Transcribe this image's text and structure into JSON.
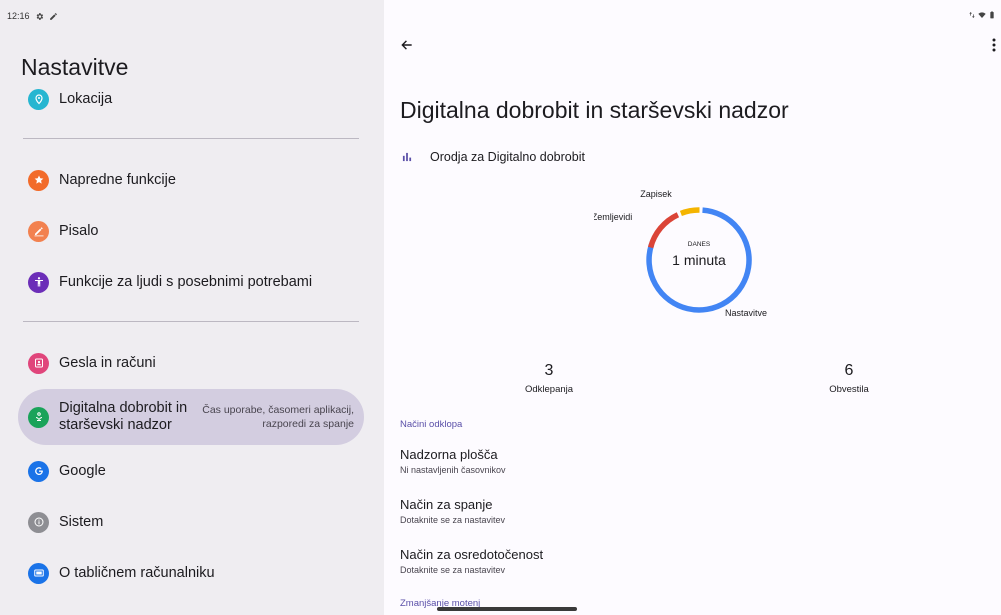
{
  "status_bar": {
    "time": "12:16"
  },
  "left": {
    "title": "Nastavitve",
    "items": [
      {
        "label": "Lokacija",
        "icon": "location-pin-icon",
        "color": "#26b6d1"
      },
      {
        "label": "Napredne funkcije",
        "icon": "star-icon",
        "color": "#f26b2a"
      },
      {
        "label": "Pisalo",
        "icon": "pen-icon",
        "color": "#f2814f"
      },
      {
        "label": "Funkcije za ljudi s posebnimi potrebami",
        "icon": "accessibility-icon",
        "color": "#6c2eb8"
      },
      {
        "label": "Gesla in računi",
        "icon": "account-icon",
        "color": "#e0457b"
      },
      {
        "label": "Digitalna dobrobit in starševski nadzor",
        "sub": "Čas uporabe, časomeri aplikacij, razporedi za spanje",
        "icon": "wellbeing-icon",
        "color": "#1aa35a"
      },
      {
        "label": "Google",
        "icon": "google-icon",
        "color": "#1a73e8"
      },
      {
        "label": "Sistem",
        "icon": "info-icon",
        "color": "#8e8e93"
      },
      {
        "label": "O tabličnem računalniku",
        "icon": "tablet-icon",
        "color": "#1a73e8"
      }
    ]
  },
  "right": {
    "title": "Digitalna dobrobit in starševski nadzor",
    "tools_label": "Orodja za Digitalno dobrobit",
    "chart": {
      "center_caption": "DANES",
      "center_value": "1 minuta",
      "labels": {
        "zapisek": "Zapisek",
        "zemljevidi": "Zemljevidi",
        "nastavitve": "Nastavitve"
      },
      "colors": {
        "nastavitve": "#4285f4",
        "zemljevidi": "#db4437",
        "zapisek": "#f4b400"
      }
    },
    "stats": [
      {
        "value": "3",
        "label": "Odklepanja"
      },
      {
        "value": "6",
        "label": "Obvestila"
      }
    ],
    "section_header": "Načini odklopa",
    "modes": [
      {
        "title": "Nadzorna plošča",
        "sub": "Ni nastavljenih časovnikov"
      },
      {
        "title": "Način za spanje",
        "sub": "Dotaknite se za nastavitev"
      },
      {
        "title": "Način za osredotočenost",
        "sub": "Dotaknite se za nastavitev"
      }
    ],
    "cut_header": "Zmanjšanje motenj"
  }
}
